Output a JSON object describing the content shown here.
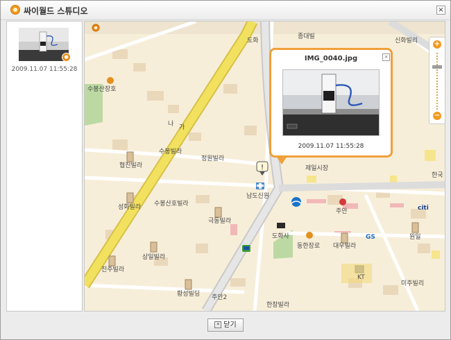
{
  "window": {
    "title": "싸이월드 스튜디오",
    "close_icon": "×"
  },
  "thumbnail": {
    "date": "2009.11.07 11:55:28"
  },
  "popup": {
    "title": "IMG_0040.jpg",
    "date": "2009.11.07 11:55:28",
    "close_icon": "×"
  },
  "zoom": {
    "plus": "+",
    "minus": "−"
  },
  "map": {
    "labels": {
      "dohwa": "도화",
      "joongdae": "종대빌",
      "sinhwa": "신화빌리",
      "subongsanjeong": "수봉산장호",
      "na": "나",
      "ga": "가",
      "subongvilla": "수봉빌라",
      "jeongwon": "정원빌라",
      "hyeopjin": "협진빌라",
      "jeilsijang": "제일시장",
      "hankuk": "한국",
      "namdong": "남도신원",
      "seonghwa": "성화빌라",
      "subongsanho": "수봉산호빌라",
      "juan": "주안",
      "geukdong": "극동빌라",
      "citi": "citi",
      "wonil": "원일",
      "dohwasa": "도화사",
      "donghan": "동한장로",
      "daewoo": "대우빌라",
      "sangil": "상일빌라",
      "jinju": "진주빌라",
      "kt": "KT",
      "miju": "미주빌리",
      "hwangseong": "황성빌딩",
      "juan2": "주안2",
      "hanchang": "한창빌라",
      "gs": "GS"
    }
  }
}
